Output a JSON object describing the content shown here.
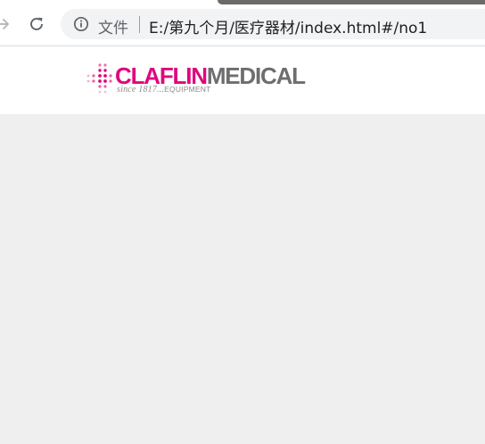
{
  "browser": {
    "security_label": "文件",
    "url": "E:/第九个月/医疗器材/index.html#/no1",
    "icons": [
      "forward-arrow-icon",
      "reload-icon",
      "info-icon"
    ]
  },
  "site": {
    "logo": {
      "brand_primary": "CLAFLIN",
      "brand_secondary": "MEDICAL",
      "tagline_script": "since 1817...",
      "tagline_caps": "EQUIPMENT",
      "primary_color": "#e0067e",
      "secondary_color": "#6d6e70"
    }
  },
  "colors": {
    "page_background": "#efefef",
    "header_background": "#ffffff"
  }
}
